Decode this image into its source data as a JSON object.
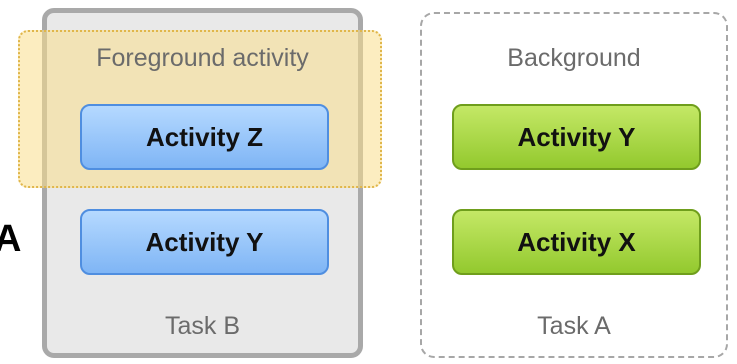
{
  "cutoff_letter": "A",
  "foreground": {
    "label": "Foreground activity"
  },
  "background": {
    "label": "Background"
  },
  "task_b": {
    "label": "Task B",
    "activities": [
      "Activity Z",
      "Activity Y"
    ]
  },
  "task_a": {
    "label": "Task A",
    "activities": [
      "Activity Y",
      "Activity X"
    ]
  },
  "colors": {
    "foreground_highlight": "#fade8c",
    "blue_activity": "#7fb5f5",
    "green_activity": "#93c92e",
    "task_b_fill": "#e9e9e9"
  }
}
